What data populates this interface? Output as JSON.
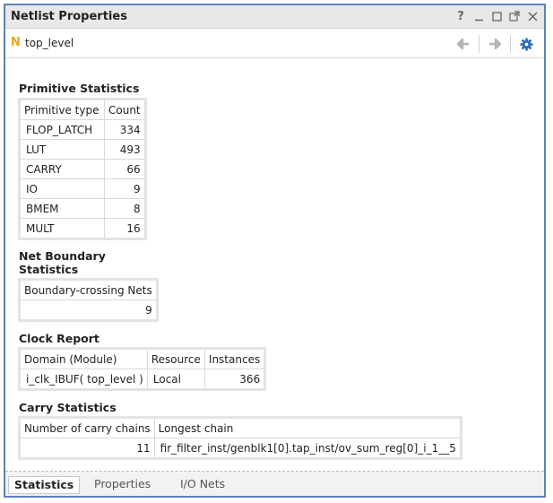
{
  "window": {
    "title": "Netlist Properties",
    "controls": {
      "help": "?",
      "minimize": "_"
    }
  },
  "toolbar": {
    "object_icon": "N",
    "object_name": "top_level"
  },
  "primitive": {
    "title": "Primitive Statistics",
    "headers": [
      "Primitive type",
      "Count"
    ],
    "rows": [
      [
        "FLOP_LATCH",
        "334"
      ],
      [
        "LUT",
        "493"
      ],
      [
        "CARRY",
        "66"
      ],
      [
        "IO",
        "9"
      ],
      [
        "BMEM",
        "8"
      ],
      [
        "MULT",
        "16"
      ]
    ]
  },
  "net_boundary": {
    "title_line1": "Net Boundary",
    "title_line2": "Statistics",
    "header": "Boundary-crossing Nets",
    "value": "9"
  },
  "clock": {
    "title": "Clock Report",
    "headers": [
      "Domain (Module)",
      "Resource",
      "Instances"
    ],
    "row": [
      "i_clk_IBUF( top_level )",
      "Local",
      "366"
    ]
  },
  "carry": {
    "title": "Carry Statistics",
    "headers": [
      "Number of carry chains",
      "Longest chain"
    ],
    "row": [
      "11",
      "fir_filter_inst/genblk1[0].tap_inst/ov_sum_reg[0]_i_1__5"
    ]
  },
  "tabs": [
    "Statistics",
    "Properties",
    "I/O Nets"
  ],
  "colors": {
    "window_border": "#5b82b9",
    "n_icon": "#e6a817",
    "gear": "#2a6db5"
  }
}
